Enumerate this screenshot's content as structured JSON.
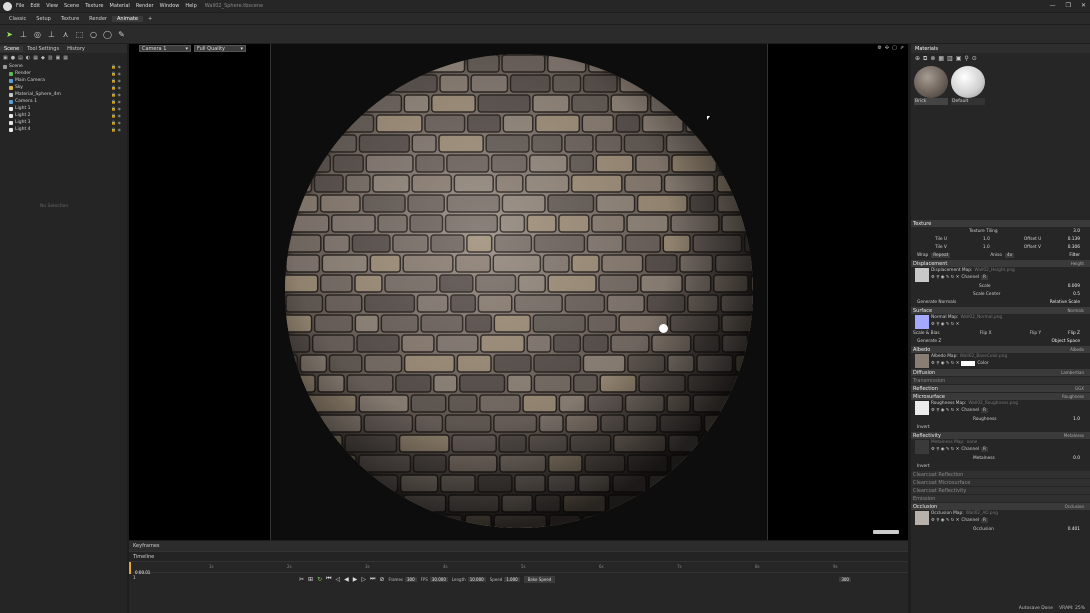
{
  "window": {
    "title": "Wall02_Sphere.tbscene",
    "controls": [
      "—",
      "❐",
      "✕"
    ]
  },
  "menu": [
    "File",
    "Edit",
    "View",
    "Scene",
    "Texture",
    "Material",
    "Render",
    "Window",
    "Help"
  ],
  "tabs": [
    "Classic",
    "Setup",
    "Texture",
    "Render",
    "Animate"
  ],
  "tab_add": "+",
  "active_tab": "Animate",
  "left_panel": {
    "tabs": [
      "Scene",
      "Tool Settings",
      "History"
    ],
    "items": [
      {
        "label": "Scene",
        "color": "#9a9a9a"
      },
      {
        "label": "Render",
        "color": "#5fb85a"
      },
      {
        "label": "Main Camera",
        "color": "#5aa0d8"
      },
      {
        "label": "Sky",
        "color": "#e0b84a"
      },
      {
        "label": "Material_Sphere_4m",
        "color": "#c8c8c8"
      },
      {
        "label": "Camera 1",
        "color": "#5aa0d8"
      },
      {
        "label": "Light 1",
        "color": "#e8e8e8"
      },
      {
        "label": "Light 2",
        "color": "#e8e8e8"
      },
      {
        "label": "Light 3",
        "color": "#e8e8e8"
      },
      {
        "label": "Light 4",
        "color": "#e8e8e8"
      }
    ],
    "no_selection": "No Selection"
  },
  "viewport": {
    "camera": "Camera 1",
    "quality": "Full Quality"
  },
  "timeline": {
    "keyframes_label": "Keyframes",
    "timeline_label": "Timeline",
    "ticks": [
      "1s",
      "2s",
      "3s",
      "4s",
      "5s",
      "6s",
      "7s",
      "8s",
      "9s"
    ],
    "current_time": "0:00.01",
    "frame": "1",
    "frames_label": "Frames",
    "frames": "300",
    "fps_label": "FPS",
    "fps": "30.000",
    "length_label": "Length",
    "length": "10.000",
    "speed_label": "Speed",
    "speed": "1.000",
    "bake_label": "Bake Speed",
    "end_frame": "300"
  },
  "materials": {
    "title": "Materials",
    "items": [
      {
        "label": "Brick",
        "color": "#8a8078"
      },
      {
        "label": "Default",
        "color": "#e0e0e0"
      }
    ]
  },
  "properties": {
    "texture": {
      "title": "Texture",
      "tiling_label": "Texture Tiling",
      "tiling": "3.0",
      "tile_u_label": "Tile U",
      "tile_u": "1.0",
      "offset_u_label": "Offset U",
      "offset_u": "0.139",
      "tile_v_label": "Tile V",
      "tile_v": "1.0",
      "offset_v_label": "Offset V",
      "offset_v": "0.306",
      "wrap_label": "Wrap",
      "wrap": "Repeat",
      "aniso_label": "Aniso",
      "aniso": "4x",
      "filter": "Filter"
    },
    "displacement": {
      "title": "Displacement",
      "mode": "Height",
      "map_label": "Displacement Map:",
      "map": "Wall02_Height.png",
      "channel_label": "Channel",
      "channel": "R",
      "scale_label": "Scale",
      "scale": "0.009",
      "center_label": "Scale Center",
      "center": "0.5",
      "gen_normals": "Generate Normals",
      "relative": "Relative Scale"
    },
    "surface": {
      "title": "Surface",
      "mode": "Normals",
      "map_label": "Normal Map:",
      "map": "Wall02_Normal.png",
      "scale_bias": "Scale & Bias",
      "flip_x": "Flip X",
      "flip_y": "Flip Y",
      "flip_z": "Flip Z",
      "generate_z": "Generate Z",
      "object_space": "Object Space"
    },
    "albedo": {
      "title": "Albedo",
      "mode": "Albedo",
      "map_label": "Albedo Map:",
      "map": "Wall02_BaseColor.png",
      "color_label": "Color"
    },
    "diffusion": {
      "title": "Diffusion",
      "mode": "Lambertian",
      "transmission": "Transmission"
    },
    "reflection": {
      "title": "Reflection",
      "mode": "GGX"
    },
    "microsurface": {
      "title": "Microsurface",
      "mode": "Roughness",
      "map_label": "Roughness Map:",
      "map": "Wall02_Roughness.png",
      "channel_label": "Channel",
      "channel": "R",
      "value_label": "Roughness",
      "value": "1.0",
      "invert": "Invert"
    },
    "reflectivity": {
      "title": "Reflectivity",
      "mode": "Metalness",
      "map_label": "Metalness Map:",
      "map": "none",
      "channel_label": "Channel",
      "channel": "R",
      "value_label": "Metalness",
      "value": "0.0",
      "invert": "Invert"
    },
    "extras": [
      "Clearcoat Reflection",
      "Clearcoat Microsurface",
      "Clearcoat Reflectivity",
      "Emission"
    ],
    "occlusion": {
      "title": "Occlusion",
      "mode": "Occlusion",
      "map_label": "Occlusion Map:",
      "map": "Wall02_AO.png",
      "channel_label": "Channel",
      "channel": "R",
      "value_label": "Occlusion",
      "value": "0.401"
    }
  },
  "status": {
    "autosave": "Autosave Done",
    "vram": "VRAM: 25%"
  }
}
